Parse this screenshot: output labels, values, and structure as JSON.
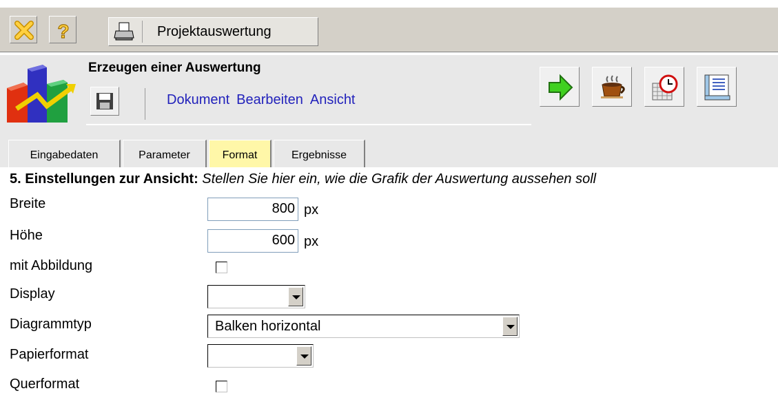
{
  "toolbar": {
    "report_button_label": "Projektauswertung"
  },
  "header": {
    "title": "Erzeugen einer Auswertung",
    "menu": [
      "Dokument",
      "Bearbeiten",
      "Ansicht"
    ]
  },
  "tabs": [
    {
      "label": "Eingabedaten",
      "active": false
    },
    {
      "label": "Parameter",
      "active": false
    },
    {
      "label": "Format",
      "active": true
    },
    {
      "label": "Ergebnisse",
      "active": false
    }
  ],
  "section": {
    "heading_bold": "5. Einstellungen zur Ansicht:",
    "heading_italic": "Stellen Sie hier ein, wie die Grafik der Auswertung aussehen soll"
  },
  "form": {
    "breite": {
      "label": "Breite",
      "value": "800",
      "unit": "px"
    },
    "hoehe": {
      "label": "Höhe",
      "value": "600",
      "unit": "px"
    },
    "mit_abbildung": {
      "label": "mit Abbildung",
      "checked": false
    },
    "display": {
      "label": "Display",
      "value": ""
    },
    "diagrammtyp": {
      "label": "Diagrammtyp",
      "value": "Balken horizontal"
    },
    "papierformat": {
      "label": "Papierformat",
      "value": ""
    },
    "querformat": {
      "label": "Querformat",
      "checked": false
    }
  },
  "colors": {
    "toolbar_bg": "#d4d0c8",
    "panel_bg": "#e8e8e8",
    "menu_link": "#2222bb",
    "active_tab": "#fff7a8"
  }
}
